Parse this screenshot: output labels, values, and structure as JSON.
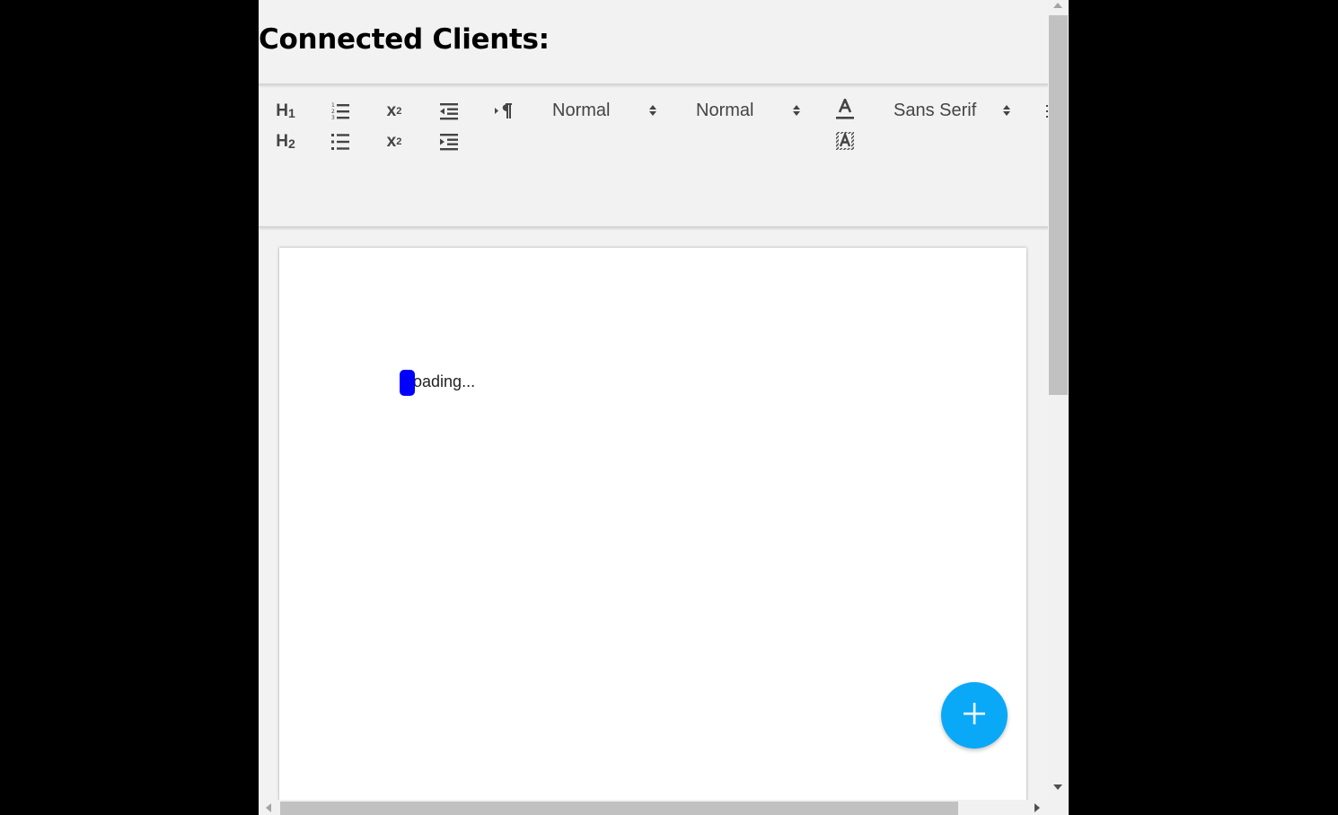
{
  "page": {
    "heading": "Connected Clients:"
  },
  "toolbar": {
    "header1": {
      "label": "H",
      "sub": "1"
    },
    "header2": {
      "label": "H",
      "sub": "2"
    },
    "subscript": {
      "label": "x",
      "sub": "2"
    },
    "superscript": {
      "label": "x",
      "sup": "2"
    },
    "size_picker": "Normal",
    "header_picker": "Normal",
    "font_picker": "Sans Serif",
    "icons": [
      "ordered-list-icon",
      "bullet-list-icon",
      "outdent-icon",
      "indent-icon",
      "text-direction-icon",
      "font-color-icon",
      "background-color-icon",
      "chevron-up-down-icon"
    ]
  },
  "editor": {
    "content": "Loading...",
    "cursor_color": "#0000ff"
  },
  "fab": {
    "icon": "plus-icon",
    "color": "#0aa9f7"
  },
  "colors": {
    "background": "#000000",
    "panel": "#f2f2f2",
    "page": "#ffffff"
  }
}
